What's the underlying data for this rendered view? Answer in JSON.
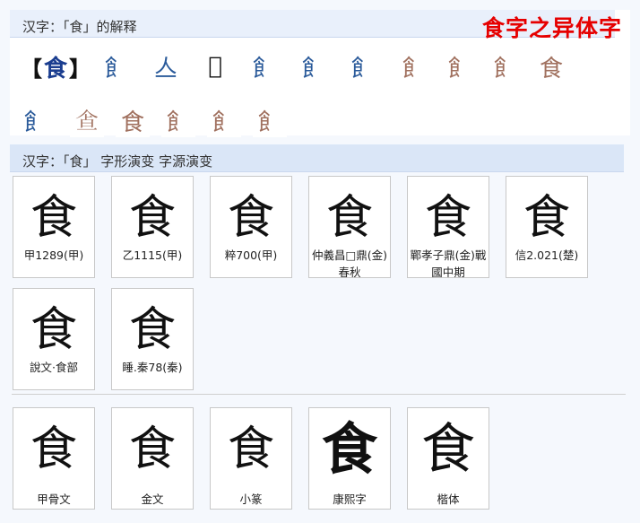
{
  "panel1": {
    "header": "汉字：「食」的解释",
    "banner": "食字之异体字",
    "bracket_open": "【",
    "main_char": "食",
    "bracket_close": "】",
    "row1": [
      {
        "char": "飠",
        "style": "blue"
      },
      {
        "char": "亼",
        "style": "blue"
      },
      {
        "char": "𠊊",
        "style": "black"
      },
      {
        "char": "飠",
        "style": "blue"
      },
      {
        "char": "飠",
        "style": "blue"
      },
      {
        "char": "飠",
        "style": "blue"
      },
      {
        "char": "飠",
        "style": "img"
      },
      {
        "char": "飠",
        "style": "img"
      },
      {
        "char": "飠",
        "style": "img"
      },
      {
        "char": "食",
        "style": "img"
      }
    ],
    "row2": [
      {
        "char": "飠",
        "style": "blue"
      },
      {
        "char": "𩚃",
        "style": "img"
      },
      {
        "char": "食",
        "style": "img"
      },
      {
        "char": "飠",
        "style": "img"
      },
      {
        "char": "飠",
        "style": "img"
      },
      {
        "char": "飠",
        "style": "img"
      }
    ]
  },
  "panel2": {
    "header_prefix": "汉字：「食」",
    "link1": "字形演变",
    "link2": "字源演变",
    "cards_top": [
      {
        "glyph": "食",
        "caption": "甲1289(甲)"
      },
      {
        "glyph": "食",
        "caption": "乙1115(甲)"
      },
      {
        "glyph": "食",
        "caption": "粹700(甲)"
      },
      {
        "glyph": "食",
        "caption": "仲義昌□鼎(金)春秋"
      },
      {
        "glyph": "食",
        "caption": "鄲孝子鼎(金)戰國中期"
      },
      {
        "glyph": "食",
        "caption": "信2.021(楚)"
      }
    ],
    "cards_mid": [
      {
        "glyph": "食",
        "caption": "說文·食部"
      },
      {
        "glyph": "食",
        "caption": "睡.秦78(秦)"
      }
    ],
    "cards_bottom": [
      {
        "glyph": "食",
        "caption": "甲骨文"
      },
      {
        "glyph": "食",
        "caption": "金文"
      },
      {
        "glyph": "食",
        "caption": "小篆"
      },
      {
        "glyph": "食",
        "caption": "康熙字"
      },
      {
        "glyph": "食",
        "caption": "楷体"
      }
    ]
  }
}
